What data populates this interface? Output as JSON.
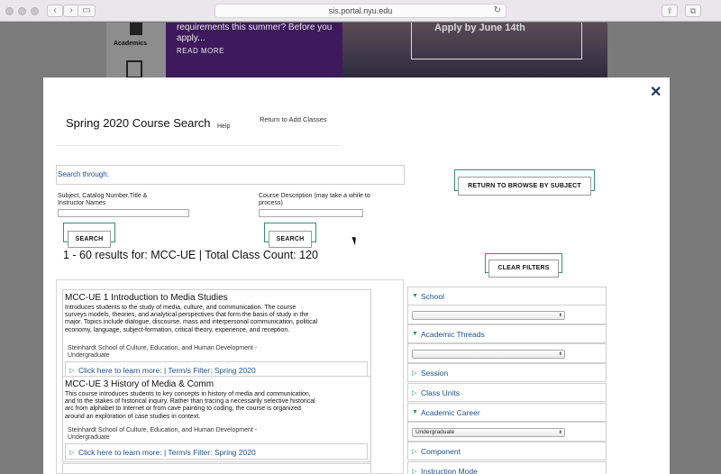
{
  "browser": {
    "url": "sis.portal.nyu.edu",
    "back_glyph": "‹",
    "forward_glyph": "›",
    "sidebar_glyph": "▭",
    "reload_glyph": "↻",
    "share_glyph": "⇪",
    "tabs_glyph": "⧉"
  },
  "background": {
    "sidebar_label": "Academics",
    "banner_text": "requirements this summer? Before you apply...",
    "banner_link": "READ MORE",
    "photo_text": "Apply by June 14th"
  },
  "modal": {
    "close_glyph": "✕",
    "title": "Spring 2020 Course Search",
    "help_link": "Help",
    "return_add_link": "Return to Add Classes",
    "search_through_label": "Search through:",
    "subject_label": "Subject, Catalog Number,Title & Instructor Names",
    "description_label": "Course Description (may take a while to process)",
    "search_button": "SEARCH",
    "search_button_2": "SEARCH",
    "return_browse_button": "RETURN TO BROWSE BY SUBJECT",
    "clear_filters_button": "CLEAR FILTERS",
    "results_summary": "1 - 60 results for: MCC-UE | Total Class Count: 120"
  },
  "courses": [
    {
      "title": "MCC-UE 1 Introduction to Media Studies",
      "description": "Introduces students to the study of media, culture, and communication. The course surveys models, theories, and analytical perspectives that form the basis of study in the major. Topics include dialogue, discourse, mass and interpersonal communication, political economy, language, subject-formation, critical theory, experience, and reception.",
      "school": "Steinhardt School of Culture, Education, and Human Development - Undergraduate",
      "link": "Click here to learn more: | Term/s Filter: Spring 2020"
    },
    {
      "title": "MCC-UE 3 History of Media & Comm",
      "description": "This course introduces students to key concepts in history of media and communication, and to the stakes of historical inquiry. Rather than tracing a necessarily selective historical arc from alphabet to Internet or from cave painting to coding, the course is organized around an exploration of case studies in context.",
      "school": "Steinhardt School of Culture, Education, and Human Development - Undergraduate",
      "link": "Click here to learn more: | Term/s Filter: Spring 2020"
    }
  ],
  "filters": [
    {
      "label": "School",
      "expanded": true
    },
    {
      "label": "Academic Threads",
      "expanded": true
    },
    {
      "label": "Session",
      "expanded": false
    },
    {
      "label": "Class Units",
      "expanded": false
    },
    {
      "label": "Academic Career",
      "expanded": true,
      "selected": "Undergraduate"
    },
    {
      "label": "Component",
      "expanded": false
    },
    {
      "label": "Instruction Mode",
      "expanded": false
    }
  ],
  "icons": {
    "expanded_glyph": "▼",
    "collapsed_glyph": "▷",
    "select_arrow": "⬍"
  }
}
